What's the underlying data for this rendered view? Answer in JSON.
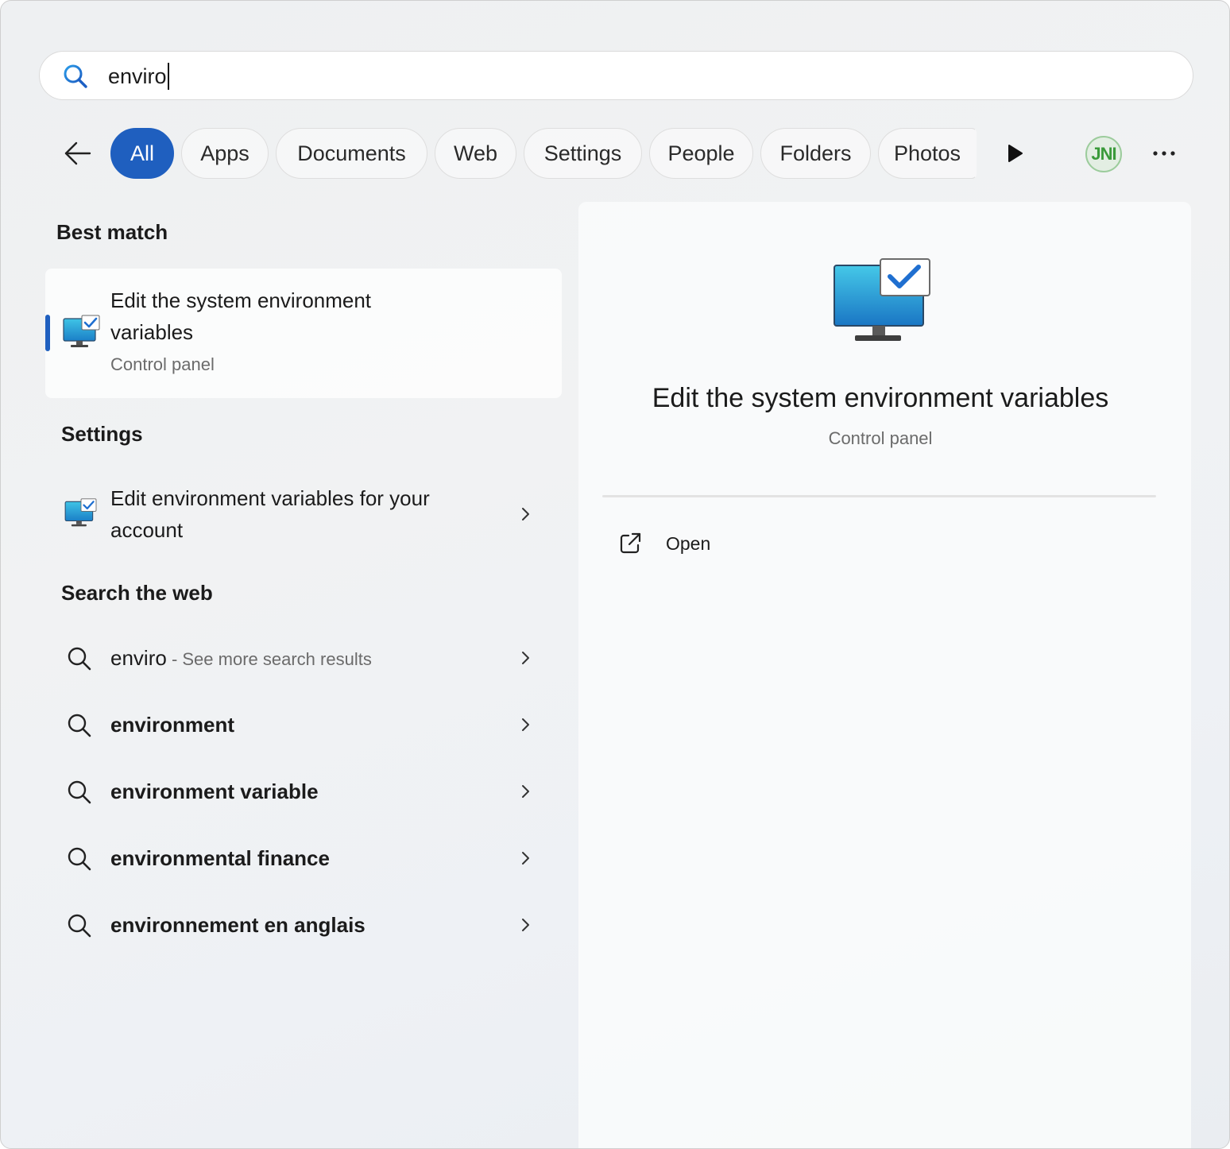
{
  "search": {
    "value": "enviro",
    "placeholder": ""
  },
  "filters": {
    "back_icon": "arrow-left-icon",
    "tabs": [
      {
        "label": "All",
        "active": true
      },
      {
        "label": "Apps"
      },
      {
        "label": "Documents"
      },
      {
        "label": "Web"
      },
      {
        "label": "Settings"
      },
      {
        "label": "People"
      },
      {
        "label": "Folders"
      },
      {
        "label": "Photos"
      }
    ],
    "play_icon": "play-icon",
    "avatar_text": "JNI",
    "more_label": "···"
  },
  "best_match": {
    "heading": "Best match",
    "title_line1": "Edit the system environment",
    "title_line2": "variables",
    "subtitle": "Control panel",
    "icon": "monitor-check-icon"
  },
  "settings": {
    "heading": "Settings",
    "items": [
      {
        "line1": "Edit environment variables for your",
        "line2": "account",
        "icon": "monitor-check-icon"
      }
    ]
  },
  "web": {
    "heading": "Search the web",
    "items": [
      {
        "text": "enviro",
        "hint": " - See more search results"
      },
      {
        "text": "environment"
      },
      {
        "text": "environment variable"
      },
      {
        "text": "environmental finance"
      },
      {
        "text": "environnement en anglais"
      }
    ]
  },
  "detail": {
    "title": "Edit the system environment variables",
    "subtitle": "Control panel",
    "actions": [
      {
        "label": "Open",
        "icon": "open-external-icon"
      }
    ]
  },
  "colors": {
    "accent": "#1f5fbf",
    "avatar_green": "#3a9a3a"
  }
}
